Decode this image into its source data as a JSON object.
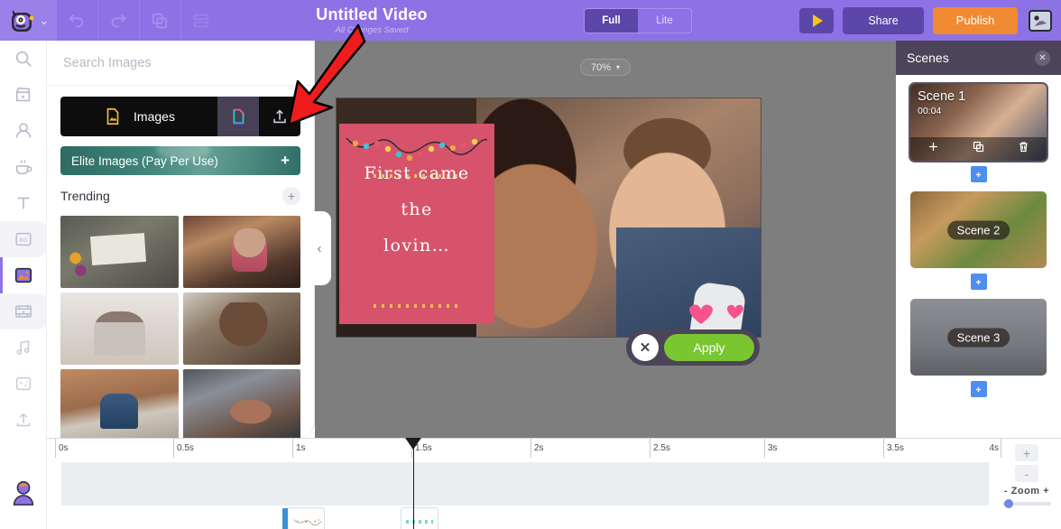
{
  "header": {
    "title": "Untitled Video",
    "subtitle": "All Changes Saved",
    "logo_icon": "monster-logo-icon",
    "caret_icon": "chevron-down-icon",
    "undo_icon": "undo-icon",
    "redo_icon": "redo-icon",
    "duplicate_icon": "duplicate-icon",
    "layers_icon": "layers-icon",
    "mode_full": "Full",
    "mode_lite": "Lite",
    "play_icon": "play-icon",
    "share_label": "Share",
    "publish_label": "Publish",
    "avatar_icon": "user-avatar-icon"
  },
  "rail": {
    "items": [
      {
        "name": "search-icon",
        "label": "Search"
      },
      {
        "name": "template-icon",
        "label": "Templates"
      },
      {
        "name": "character-icon",
        "label": "Characters"
      },
      {
        "name": "props-icon",
        "label": "Props"
      },
      {
        "name": "text-icon",
        "label": "Text"
      },
      {
        "name": "bg-icon",
        "label": "BG"
      },
      {
        "name": "image-icon",
        "label": "Images"
      },
      {
        "name": "video-icon",
        "label": "Video"
      },
      {
        "name": "music-icon",
        "label": "Music"
      },
      {
        "name": "effects-icon",
        "label": "Effects"
      },
      {
        "name": "upload-icon",
        "label": "Upload"
      }
    ],
    "account_icon": "account-avatar-icon"
  },
  "panel": {
    "search_placeholder": "Search Images",
    "images_tab_label": "Images",
    "images_tab_icon": "image-file-icon",
    "brand_icon": "brand-file-icon",
    "upload_icon": "upload-arrow-icon",
    "elite_label": "Elite Images (Pay Per Use)",
    "elite_plus": "+",
    "trending_label": "Trending",
    "trending_plus": "+",
    "collapse_icon": "chevron-left-icon",
    "thumbnails": [
      {
        "alt": "protest sign no justice no peace with flowers"
      },
      {
        "alt": "woman covering face in cafe"
      },
      {
        "alt": "couple sitting on bed back turned"
      },
      {
        "alt": "man with hand on forehead"
      },
      {
        "alt": "boy sitting against brick wall"
      },
      {
        "alt": "hands held in comfort"
      }
    ]
  },
  "canvas": {
    "zoom_value": "70%",
    "zoom_caret": "▾",
    "card_lines": [
      "First came",
      "the",
      "lovin…"
    ],
    "apply_label": "Apply",
    "close_icon": "close-x-icon"
  },
  "scenes": {
    "title": "Scenes",
    "close_icon": "close-x-icon",
    "add_between_icon": "add-scene-icon",
    "items": [
      {
        "label": "Scene 1",
        "duration": "00:04",
        "selected": true,
        "actions": [
          "add-icon",
          "duplicate-icon",
          "delete-icon"
        ]
      },
      {
        "label": "Scene 2",
        "duration": "",
        "selected": false,
        "actions": []
      },
      {
        "label": "Scene 3",
        "duration": "",
        "selected": false,
        "actions": []
      }
    ]
  },
  "timeline": {
    "ticks": [
      "0s",
      "0.5s",
      "1s",
      "1.5s",
      "2s",
      "2.5s",
      "3s",
      "3.5s",
      "4s"
    ],
    "zoom_label": "Zoom",
    "zoom_minus": "-",
    "zoom_plus": "+",
    "zoom_in_icon": "plus-icon",
    "zoom_out_icon": "minus-icon"
  },
  "annotation": {
    "arrow": "red-arrow-pointing-to-upload-button"
  },
  "colors": {
    "header_purple": "#8d72e6",
    "publish_orange": "#f08b33",
    "apply_green": "#79c631",
    "scenes_dark": "#4c4458",
    "accent_blue": "#4d8ff0",
    "card_pink": "#d6536b"
  }
}
